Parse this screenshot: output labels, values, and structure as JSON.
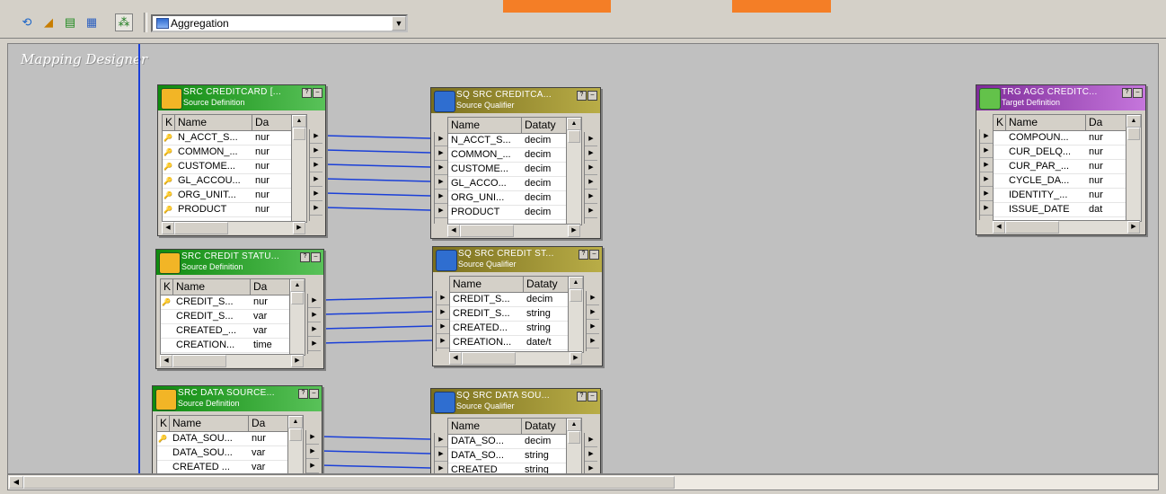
{
  "toolbar": {
    "buttons": [
      {
        "icon": "source-analyzer-icon",
        "glyph": "⟲"
      },
      {
        "icon": "target-designer-icon",
        "glyph": "◢"
      },
      {
        "icon": "transformation-developer-icon",
        "glyph": "▤"
      },
      {
        "icon": "mapplet-designer-icon",
        "glyph": "▦"
      },
      {
        "icon": "mapping-designer-icon",
        "glyph": "⁂"
      }
    ],
    "mapping_select": "Aggregation"
  },
  "canvas": {
    "title": "Mapping Designer"
  },
  "nodes": [
    {
      "id": "src-creditcard",
      "kind": "src",
      "title": "SRC CREDITCARD [...",
      "subtitle": "Source Definition",
      "cols": [
        "K",
        "Name",
        "Da"
      ],
      "rows": [
        {
          "key": "🔑",
          "name": "N_ACCT_S...",
          "type": "nur"
        },
        {
          "key": "🔑",
          "name": "COMMON_...",
          "type": "nur"
        },
        {
          "key": "🔑",
          "name": "CUSTOME...",
          "type": "nur"
        },
        {
          "key": "🔑",
          "name": "GL_ACCOU...",
          "type": "nur"
        },
        {
          "key": "🔑",
          "name": "ORG_UNIT...",
          "type": "nur"
        },
        {
          "key": "🔑",
          "name": "PRODUCT",
          "type": "nur"
        }
      ]
    },
    {
      "id": "sq-creditcard",
      "kind": "sq",
      "title": "SQ SRC CREDITCA...",
      "subtitle": "Source Qualifier",
      "cols": [
        "Name",
        "Dataty"
      ],
      "rows": [
        {
          "name": "N_ACCT_S...",
          "type": "decim"
        },
        {
          "name": "COMMON_...",
          "type": "decim"
        },
        {
          "name": "CUSTOME...",
          "type": "decim"
        },
        {
          "name": "GL_ACCO...",
          "type": "decim"
        },
        {
          "name": "ORG_UNI...",
          "type": "decim"
        },
        {
          "name": "PRODUCT",
          "type": "decim"
        }
      ]
    },
    {
      "id": "trg-agg",
      "kind": "tgt",
      "title": "TRG AGG CREDITC...",
      "subtitle": "Target Definition",
      "cols": [
        "K",
        "Name",
        "Da"
      ],
      "rows": [
        {
          "key": "",
          "name": "COMPOUN...",
          "type": "nur"
        },
        {
          "key": "",
          "name": "CUR_DELQ...",
          "type": "nur"
        },
        {
          "key": "",
          "name": "CUR_PAR_...",
          "type": "nur"
        },
        {
          "key": "",
          "name": "CYCLE_DA...",
          "type": "nur"
        },
        {
          "key": "",
          "name": "IDENTITY_...",
          "type": "nur"
        },
        {
          "key": "",
          "name": "ISSUE_DATE",
          "type": "dat"
        }
      ]
    },
    {
      "id": "src-credit-status",
      "kind": "src",
      "title": "SRC CREDIT STATU...",
      "subtitle": "Source Definition",
      "cols": [
        "K",
        "Name",
        "Da"
      ],
      "rows": [
        {
          "key": "🔑",
          "name": "CREDIT_S...",
          "type": "nur"
        },
        {
          "key": "",
          "name": "CREDIT_S...",
          "type": "var"
        },
        {
          "key": "",
          "name": "CREATED_...",
          "type": "var"
        },
        {
          "key": "",
          "name": "CREATION...",
          "type": "time"
        }
      ]
    },
    {
      "id": "sq-credit-status",
      "kind": "sq",
      "title": "SQ SRC CREDIT ST...",
      "subtitle": "Source Qualifier",
      "cols": [
        "Name",
        "Dataty"
      ],
      "rows": [
        {
          "name": "CREDIT_S...",
          "type": "decim"
        },
        {
          "name": "CREDIT_S...",
          "type": "string"
        },
        {
          "name": "CREATED...",
          "type": "string"
        },
        {
          "name": "CREATION...",
          "type": "date/t"
        }
      ]
    },
    {
      "id": "src-data-source",
      "kind": "src",
      "title": "SRC DATA SOURCE...",
      "subtitle": "Source Definition",
      "cols": [
        "K",
        "Name",
        "Da"
      ],
      "rows": [
        {
          "key": "🔑",
          "name": "DATA_SOU...",
          "type": "nur"
        },
        {
          "key": "",
          "name": "DATA_SOU...",
          "type": "var"
        },
        {
          "key": "",
          "name": "CREATED ...",
          "type": "var"
        }
      ]
    },
    {
      "id": "sq-data-source",
      "kind": "sq",
      "title": "SQ SRC DATA SOU...",
      "subtitle": "Source Qualifier",
      "cols": [
        "Name",
        "Dataty"
      ],
      "rows": [
        {
          "name": "DATA_SO...",
          "type": "decim"
        },
        {
          "name": "DATA_SO...",
          "type": "string"
        },
        {
          "name": "CREATED",
          "type": "string"
        }
      ]
    }
  ]
}
